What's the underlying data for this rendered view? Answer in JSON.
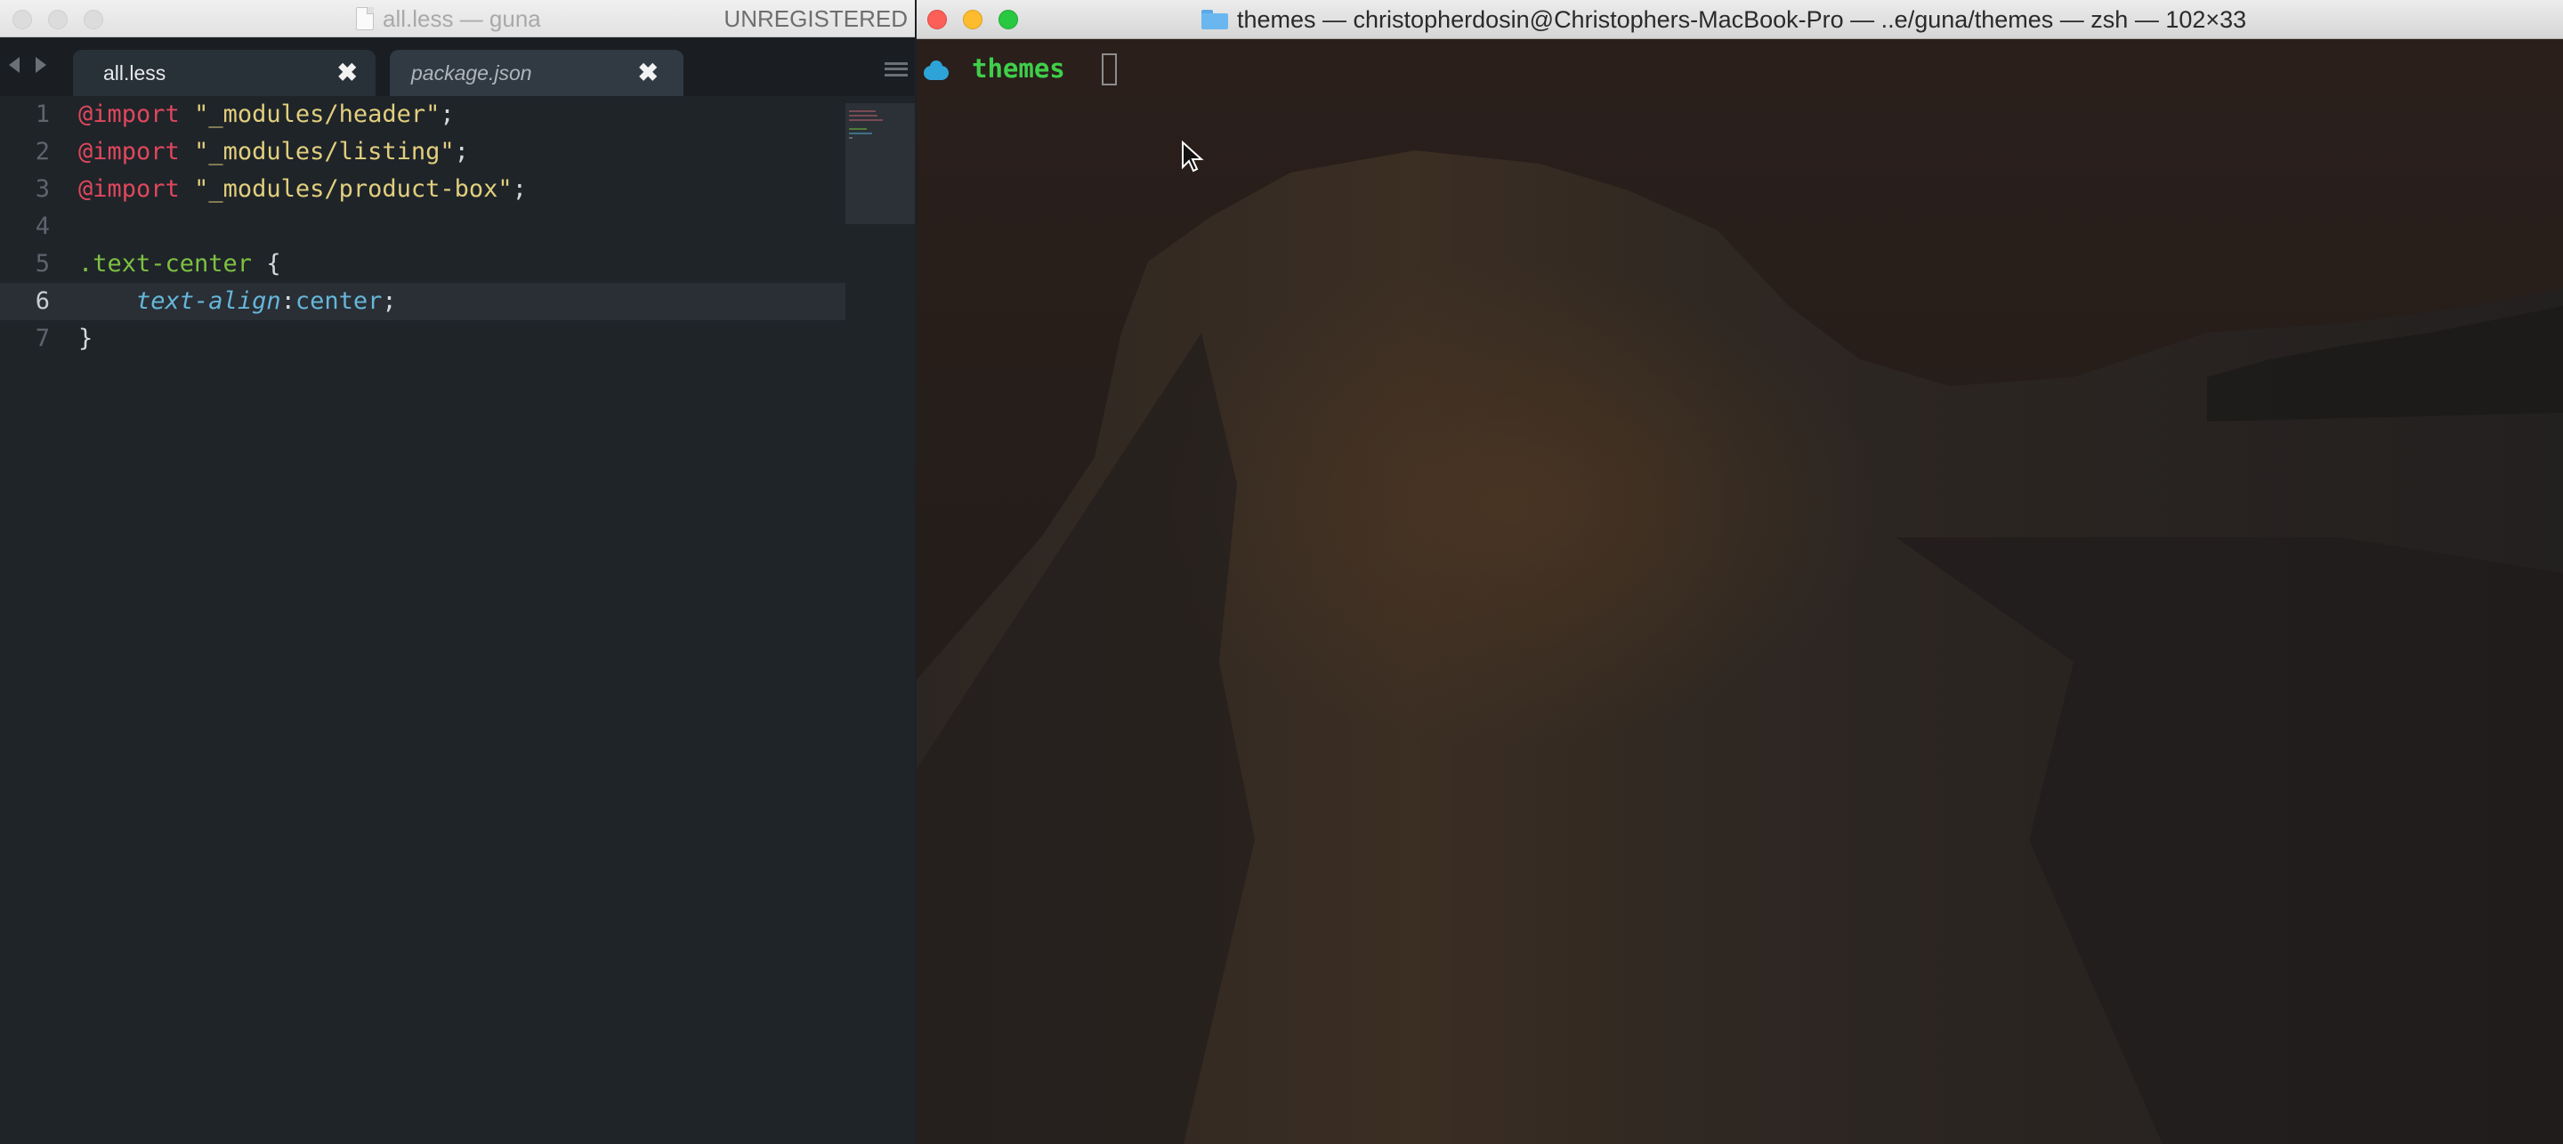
{
  "sublime": {
    "title": "all.less — guna",
    "license_status": "UNREGISTERED",
    "tabs": [
      {
        "label": "all.less",
        "active": true,
        "close": "✖"
      },
      {
        "label": "package.json",
        "active": false,
        "close": "✖"
      }
    ],
    "current_line": 6,
    "editor": {
      "lines": [
        {
          "n": "1",
          "t": [
            {
              "c": "kw",
              "v": "@import"
            },
            {
              "c": "punc",
              "v": " "
            },
            {
              "c": "str",
              "v": "\"_modules/header\""
            },
            {
              "c": "punc",
              "v": ";"
            }
          ]
        },
        {
          "n": "2",
          "t": [
            {
              "c": "kw",
              "v": "@import"
            },
            {
              "c": "punc",
              "v": " "
            },
            {
              "c": "str",
              "v": "\"_modules/listing\""
            },
            {
              "c": "punc",
              "v": ";"
            }
          ]
        },
        {
          "n": "3",
          "t": [
            {
              "c": "kw",
              "v": "@import"
            },
            {
              "c": "punc",
              "v": " "
            },
            {
              "c": "str",
              "v": "\"_modules/product-box\""
            },
            {
              "c": "punc",
              "v": ";"
            }
          ]
        },
        {
          "n": "4",
          "t": []
        },
        {
          "n": "5",
          "t": [
            {
              "c": "sel",
              "v": ".text-center"
            },
            {
              "c": "punc",
              "v": " {"
            }
          ]
        },
        {
          "n": "6",
          "t": [
            {
              "c": "punc",
              "v": "    "
            },
            {
              "c": "prop",
              "v": "text-align"
            },
            {
              "c": "punc",
              "v": ":"
            },
            {
              "c": "val",
              "v": "center"
            },
            {
              "c": "punc",
              "v": ";"
            }
          ]
        },
        {
          "n": "7",
          "t": [
            {
              "c": "punc",
              "v": "}"
            }
          ]
        }
      ]
    }
  },
  "terminal": {
    "title": "themes — christopherdosin@Christophers-MacBook-Pro — ..e/guna/themes — zsh — 102×33",
    "prompt_dir": "themes",
    "prompt_icon": "cloud-icon"
  },
  "colors": {
    "editor_bg": "#1f2429",
    "keyword": "#e0475c",
    "string": "#e2cf7d",
    "selector": "#7dc142",
    "property": "#66b6d9",
    "terminal_prompt": "#3fcf4a",
    "close_red": "#fc5f57",
    "minimize_yellow": "#fdbc2e",
    "zoom_green": "#28c840"
  }
}
